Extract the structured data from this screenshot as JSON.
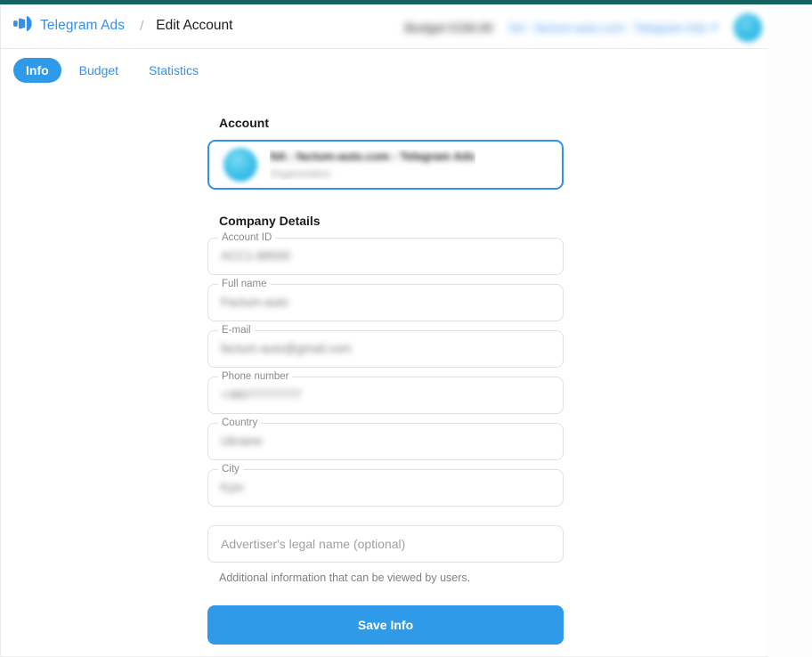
{
  "window": {
    "accent_bar_color": "#14635f"
  },
  "header": {
    "logo_icon": "megaphone-icon",
    "brand_name": "Telegram Ads",
    "breadcrumb_separator": "/",
    "breadcrumb_current": "Edit Account",
    "budget_indicator": "Budget €150.00",
    "account_switcher_label": "NA : factum-auto.com : Telegram Ads",
    "account_switcher_caret": "chevron-down-icon",
    "avatar": "user-avatar"
  },
  "tabs": [
    {
      "label": "Info",
      "active": true
    },
    {
      "label": "Budget",
      "active": false
    },
    {
      "label": "Statistics",
      "active": false
    }
  ],
  "main": {
    "account_section": {
      "heading": "Account",
      "card": {
        "avatar": "account-avatar",
        "title": "NA : factum-auto.com : Telegram Ads",
        "subtitle": "Organization"
      }
    },
    "company_details": {
      "heading": "Company Details",
      "fields": [
        {
          "label": "Account ID",
          "value": "ACC1-88500"
        },
        {
          "label": "Full name",
          "value": "Factum-auto"
        },
        {
          "label": "E-mail",
          "value": "factum-auto@gmail.com"
        },
        {
          "label": "Phone number",
          "value": "+38077777777"
        },
        {
          "label": "Country",
          "value": "Ukraine"
        },
        {
          "label": "City",
          "value": "Kyiv"
        }
      ],
      "legal_name": {
        "value": "",
        "placeholder": "Advertiser's legal name (optional)",
        "hint": "Additional information that can be viewed by users."
      },
      "save_button_label": "Save Info"
    }
  },
  "colors": {
    "brand_blue": "#3390ec",
    "accent_button": "#2f9ae8",
    "top_bar": "#14635f",
    "field_border": "#dfe1e5"
  }
}
